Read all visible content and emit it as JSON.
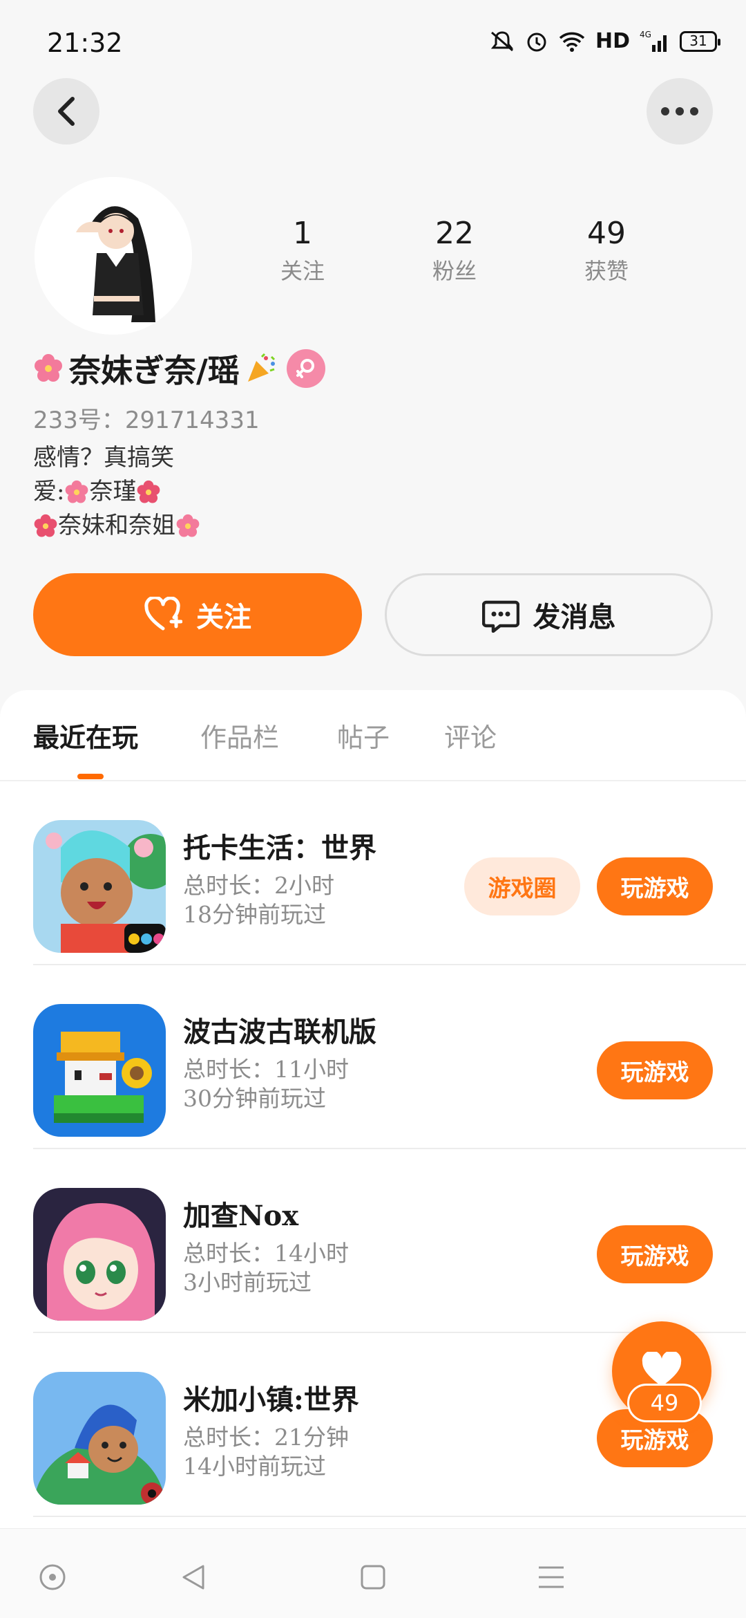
{
  "status_bar": {
    "time": "21:32",
    "network_label": "HD",
    "signal_type": "4G",
    "battery": "31"
  },
  "nav": {
    "back_icon": "chevron-left-icon",
    "more_icon": "more-dots-icon"
  },
  "profile": {
    "name": "奈妹ぎ奈/瑶",
    "gender": "female",
    "id_label": "233号：291714331",
    "stats": [
      {
        "value": "1",
        "label": "关注"
      },
      {
        "value": "22",
        "label": "粉丝"
      },
      {
        "value": "49",
        "label": "获赞"
      }
    ],
    "bio": {
      "line1": "感情？真搞笑",
      "line2_prefix": "爱:",
      "line2_name": "奈瑾",
      "line3_text": "奈妹和奈姐"
    }
  },
  "actions": {
    "follow_label": "关注",
    "message_label": "发消息"
  },
  "tabs": [
    {
      "label": "最近在玩",
      "active": true
    },
    {
      "label": "作品栏",
      "active": false
    },
    {
      "label": "帖子",
      "active": false
    },
    {
      "label": "评论",
      "active": false
    }
  ],
  "games": [
    {
      "title": "托卡生活：世界",
      "duration": "总时长：2小时",
      "last_played": "18分钟前玩过",
      "circle_label": "游戏圈",
      "play_label": "玩游戏"
    },
    {
      "title": "波古波古联机版",
      "duration": "总时长：11小时",
      "last_played": "30分钟前玩过",
      "play_label": "玩游戏"
    },
    {
      "title": "加查Nox",
      "duration": "总时长：14小时",
      "last_played": "3小时前玩过",
      "play_label": "玩游戏"
    },
    {
      "title": "米加小镇:世界",
      "duration": "总时长：21分钟",
      "last_played": "14小时前玩过",
      "play_label": "玩游戏"
    }
  ],
  "like_fab": {
    "count": "49"
  },
  "colors": {
    "accent": "#ff7614",
    "accent_light": "#ffe9db",
    "gender_badge": "#f58aa8",
    "background": "#f7f7f7"
  }
}
